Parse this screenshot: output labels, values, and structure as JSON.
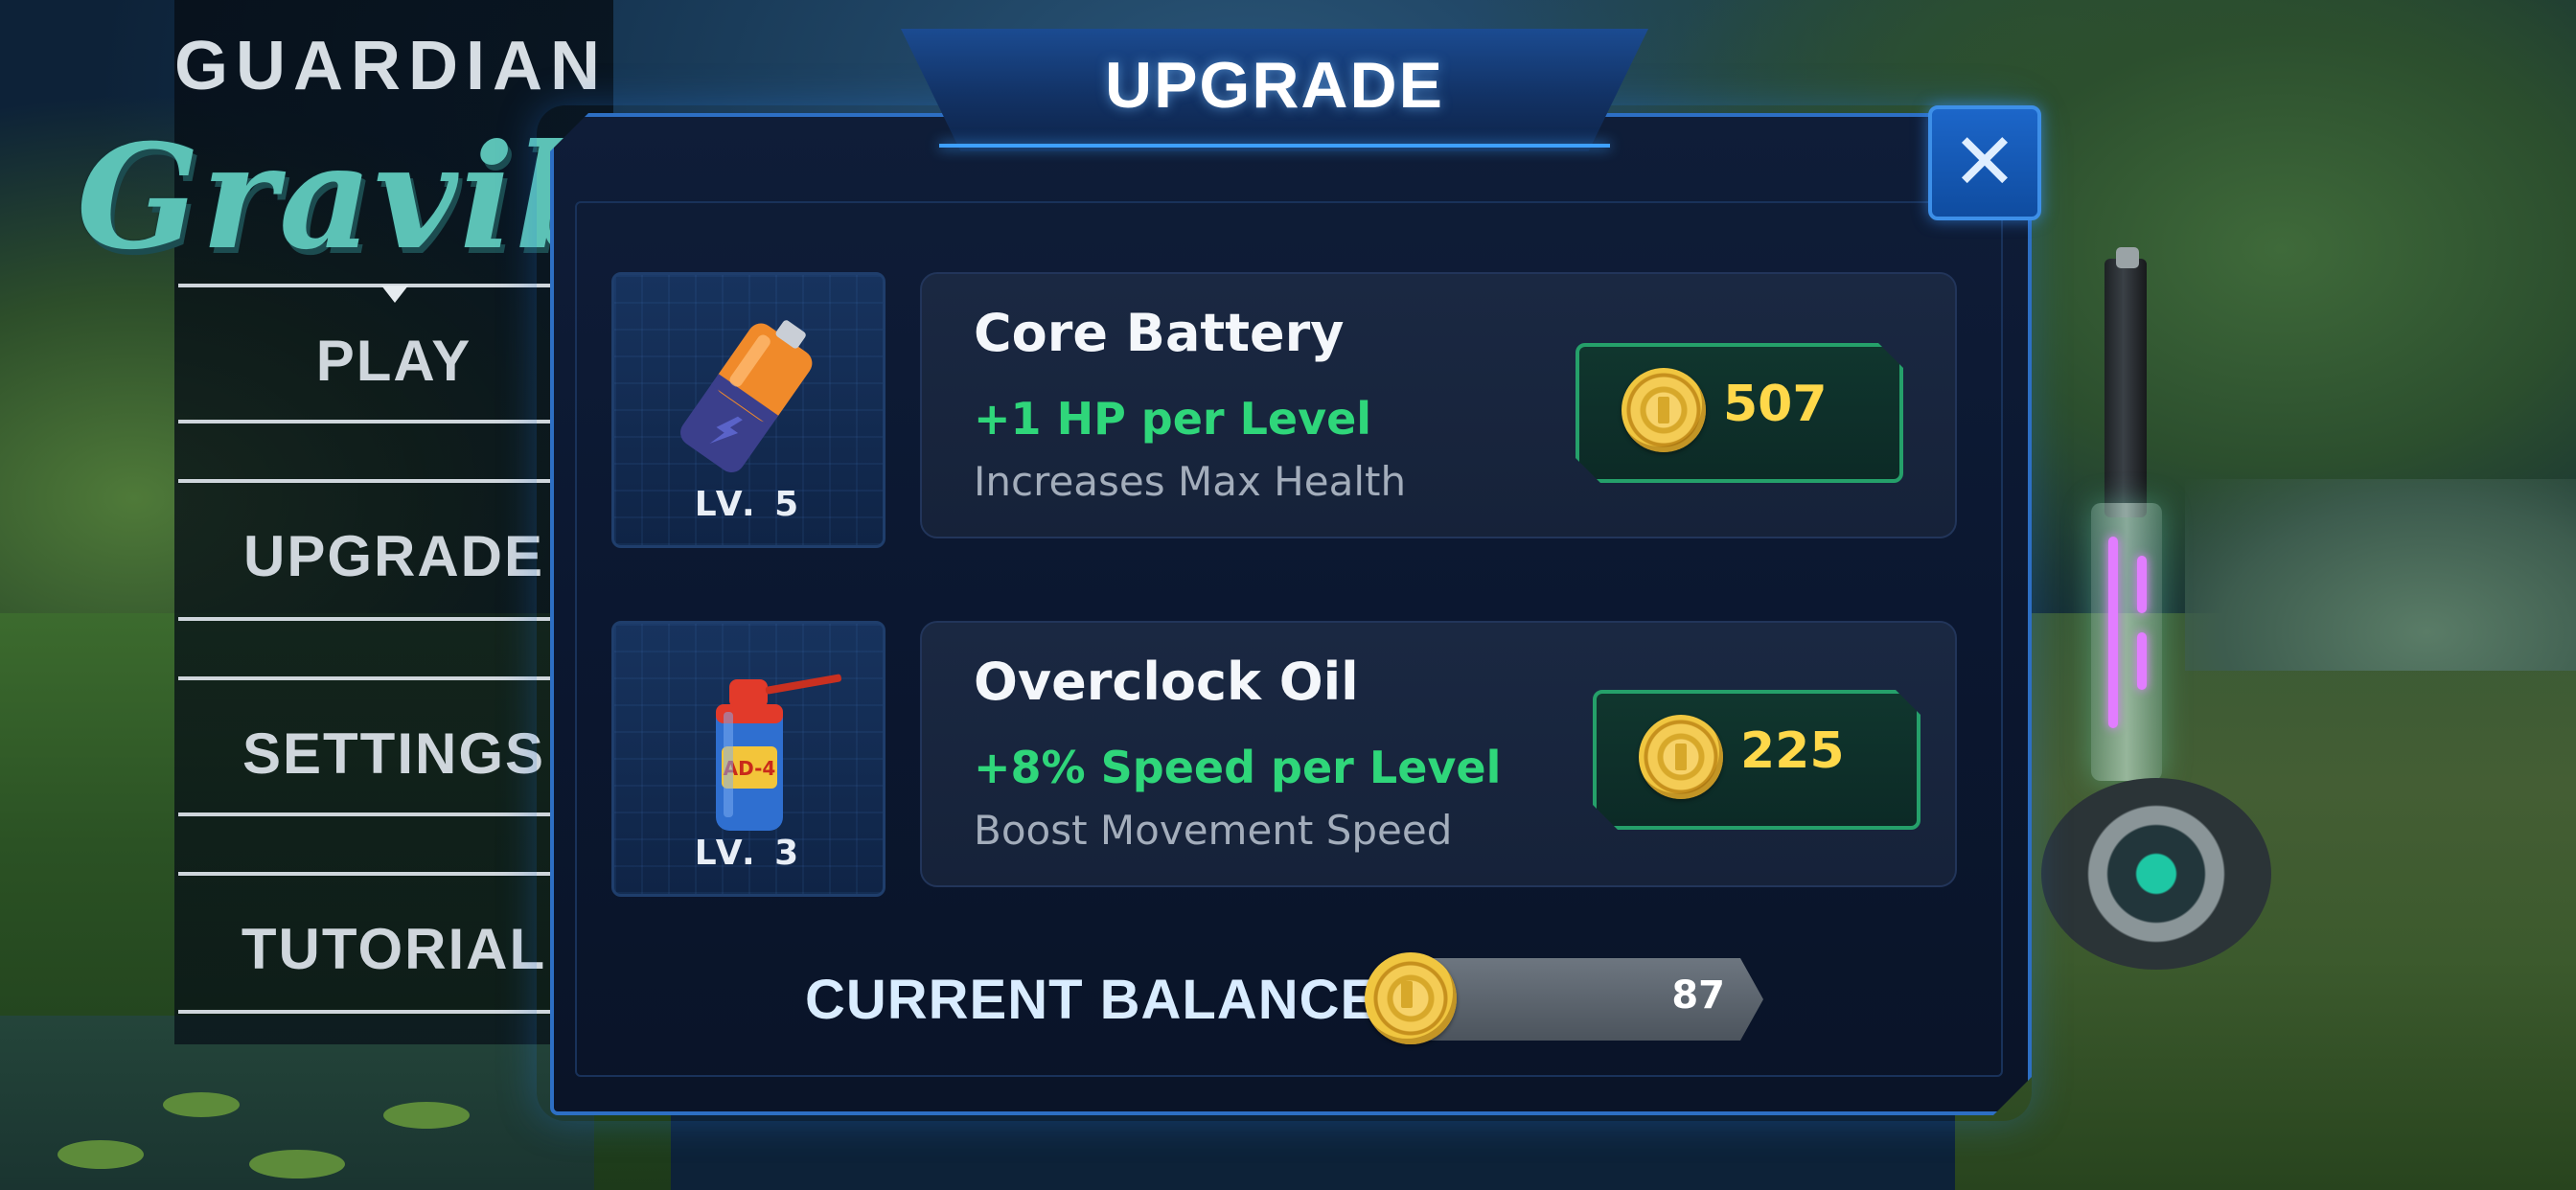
{
  "menu": {
    "title": "GUARDIAN",
    "logo": "Gravibla",
    "items": [
      {
        "label": "PLAY"
      },
      {
        "label": "UPGRADE"
      },
      {
        "label": "SETTINGS"
      },
      {
        "label": "TUTORIAL"
      }
    ]
  },
  "panel": {
    "title": "UPGRADE",
    "close_icon": "close-icon",
    "items": [
      {
        "name": "Core Battery",
        "level": "LV. 5",
        "bonus": "+1 HP per Level",
        "description": "Increases Max Health",
        "price": "507",
        "icon": "battery-icon"
      },
      {
        "name": "Overclock Oil",
        "level": "LV. 3",
        "bonus": "+8% Speed per Level",
        "description": "Boost Movement Speed",
        "price": "225",
        "icon": "oil-can-icon"
      }
    ],
    "balance_label": "CURRENT BALANCE:",
    "balance_value": "87"
  },
  "colors": {
    "accent_blue": "#2d6fc4",
    "bonus_green": "#2fd67a",
    "price_gold": "#ffd84a",
    "price_border": "#25a06a"
  }
}
